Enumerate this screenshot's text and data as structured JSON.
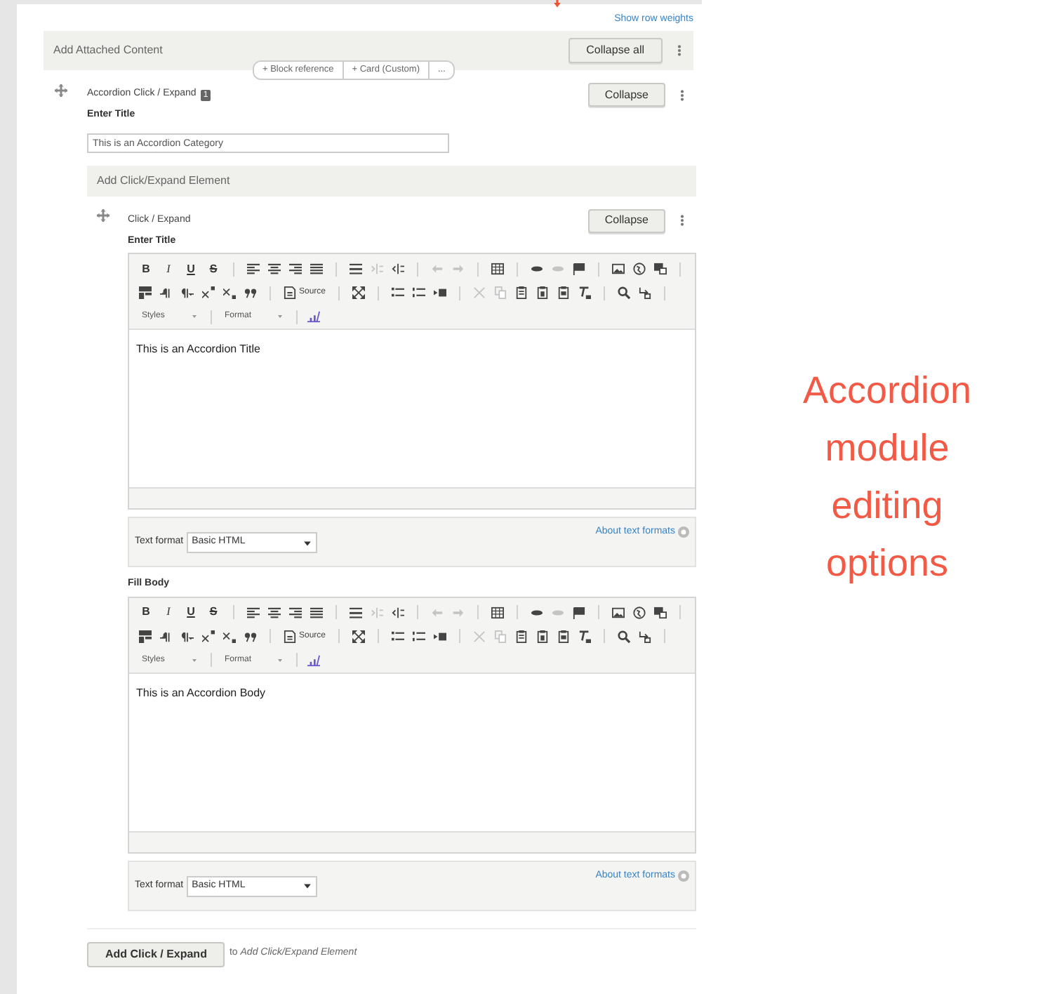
{
  "show_row_weights": "Show row weights",
  "attached": {
    "title": "Add Attached Content",
    "collapse_all": "Collapse all",
    "add_buttons": [
      "+ Block reference",
      "+ Card (Custom)",
      "..."
    ]
  },
  "paragraph": {
    "type_label": "Accordion Click / Expand",
    "badge": "1",
    "collapse": "Collapse",
    "title_label": "Enter Title",
    "title_value": "This is an Accordion Category",
    "sub_header": "Add Click/Expand Element",
    "item": {
      "type_label": "Click / Expand",
      "collapse": "Collapse",
      "fields": [
        {
          "label": "Enter Title",
          "toolbar": {
            "bold": "B",
            "italic": "I",
            "underline": "U",
            "strike": "S",
            "source": "Source",
            "styles": "Styles",
            "format": "Format"
          },
          "content": "This is an Accordion Title",
          "text_format_label": "Text format",
          "text_format": "Basic HTML",
          "about": "About text formats"
        },
        {
          "label": "Fill Body",
          "toolbar": {
            "bold": "B",
            "italic": "I",
            "underline": "U",
            "strike": "S",
            "source": "Source",
            "styles": "Styles",
            "format": "Format"
          },
          "content": "This is an Accordion Body",
          "text_format_label": "Text format",
          "text_format": "Basic HTML",
          "about": "About text formats"
        }
      ]
    },
    "add_button": "Add Click / Expand",
    "add_target": "to *Add Click/Expand Element*"
  },
  "annotation": "Accordion module editing options"
}
